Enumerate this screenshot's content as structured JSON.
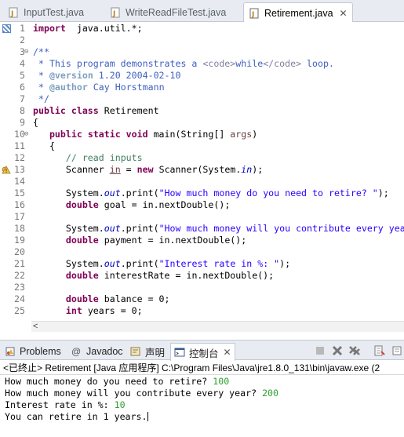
{
  "editor_tabs": [
    {
      "label": "InputTest.java",
      "active": false
    },
    {
      "label": "WriteReadFileTest.java",
      "active": false
    },
    {
      "label": "Retirement.java",
      "active": true
    }
  ],
  "tab_close_glyph": "✕",
  "code_lines": [
    {
      "n": "1",
      "fold": "",
      "segs": [
        [
          "kw",
          "import"
        ],
        [
          "",
          "  java.util.*;"
        ]
      ]
    },
    {
      "n": "2",
      "fold": "",
      "segs": []
    },
    {
      "n": "3",
      "fold": "⊖",
      "segs": [
        [
          "jd",
          "/**"
        ]
      ]
    },
    {
      "n": "4",
      "fold": "",
      "segs": [
        [
          "jd",
          " * This program demonstrates a "
        ],
        [
          "jdhtml",
          "<code>"
        ],
        [
          "jd",
          "while"
        ],
        [
          "jdhtml",
          "</code>"
        ],
        [
          "jd",
          " loop."
        ]
      ]
    },
    {
      "n": "5",
      "fold": "",
      "segs": [
        [
          "jd",
          " * "
        ],
        [
          "jdtag",
          "@version"
        ],
        [
          "jd",
          " 1.20 2004-02-10"
        ]
      ]
    },
    {
      "n": "6",
      "fold": "",
      "segs": [
        [
          "jd",
          " * "
        ],
        [
          "jdtag",
          "@author"
        ],
        [
          "jd",
          " Cay Horstmann"
        ]
      ]
    },
    {
      "n": "7",
      "fold": "",
      "segs": [
        [
          "jd",
          " */"
        ]
      ]
    },
    {
      "n": "8",
      "fold": "",
      "segs": [
        [
          "kw",
          "public class"
        ],
        [
          "",
          " Retirement"
        ]
      ]
    },
    {
      "n": "9",
      "fold": "",
      "segs": [
        [
          "",
          "{"
        ]
      ]
    },
    {
      "n": "10",
      "fold": "⊖",
      "segs": [
        [
          "",
          "   "
        ],
        [
          "kw",
          "public static void"
        ],
        [
          "",
          " main(String[] "
        ],
        [
          "lv",
          "args"
        ],
        [
          "",
          ")"
        ]
      ]
    },
    {
      "n": "11",
      "fold": "",
      "segs": [
        [
          "",
          "   {"
        ]
      ]
    },
    {
      "n": "12",
      "fold": "",
      "segs": [
        [
          "",
          "      "
        ],
        [
          "cm",
          "// read inputs"
        ]
      ]
    },
    {
      "n": "13",
      "fold": "",
      "segs": [
        [
          "",
          "      Scanner "
        ],
        [
          "lvu",
          "in"
        ],
        [
          "",
          " = "
        ],
        [
          "kw",
          "new"
        ],
        [
          "",
          " Scanner(System."
        ],
        [
          "fld",
          "in"
        ],
        [
          "",
          ");"
        ]
      ]
    },
    {
      "n": "14",
      "fold": "",
      "segs": []
    },
    {
      "n": "15",
      "fold": "",
      "segs": [
        [
          "",
          "      System."
        ],
        [
          "fld",
          "out"
        ],
        [
          "",
          ".print("
        ],
        [
          "str",
          "\"How much money do you need to retire? \""
        ],
        [
          "",
          ");"
        ]
      ]
    },
    {
      "n": "16",
      "fold": "",
      "segs": [
        [
          "",
          "      "
        ],
        [
          "kw",
          "double"
        ],
        [
          "",
          " goal = in.nextDouble();"
        ]
      ]
    },
    {
      "n": "17",
      "fold": "",
      "segs": []
    },
    {
      "n": "18",
      "fold": "",
      "segs": [
        [
          "",
          "      System."
        ],
        [
          "fld",
          "out"
        ],
        [
          "",
          ".print("
        ],
        [
          "str",
          "\"How much money will you contribute every yea"
        ]
      ]
    },
    {
      "n": "19",
      "fold": "",
      "segs": [
        [
          "",
          "      "
        ],
        [
          "kw",
          "double"
        ],
        [
          "",
          " payment = in.nextDouble();"
        ]
      ]
    },
    {
      "n": "20",
      "fold": "",
      "segs": []
    },
    {
      "n": "21",
      "fold": "",
      "segs": [
        [
          "",
          "      System."
        ],
        [
          "fld",
          "out"
        ],
        [
          "",
          ".print("
        ],
        [
          "str",
          "\"Interest rate in %: \""
        ],
        [
          "",
          ");"
        ]
      ]
    },
    {
      "n": "22",
      "fold": "",
      "segs": [
        [
          "",
          "      "
        ],
        [
          "kw",
          "double"
        ],
        [
          "",
          " interestRate = in.nextDouble();"
        ]
      ]
    },
    {
      "n": "23",
      "fold": "",
      "segs": []
    },
    {
      "n": "24",
      "fold": "",
      "segs": [
        [
          "",
          "      "
        ],
        [
          "kw",
          "double"
        ],
        [
          "",
          " balance = 0;"
        ]
      ]
    },
    {
      "n": "25",
      "fold": "",
      "segs": [
        [
          "",
          "      "
        ],
        [
          "kw",
          "int"
        ],
        [
          "",
          " years = 0;"
        ]
      ]
    }
  ],
  "scroll_left_glyph": "<",
  "panel_tabs": [
    {
      "label": "Problems",
      "active": false
    },
    {
      "label": "Javadoc",
      "active": false
    },
    {
      "label": "声明",
      "active": false
    },
    {
      "label": "控制台",
      "active": true
    }
  ],
  "console_header": "<已终止> Retirement [Java 应用程序] C:\\Program Files\\Java\\jre1.8.0_131\\bin\\javaw.exe  (2",
  "console_lines": [
    {
      "prompt": "How much money do you need to retire? ",
      "input": "100"
    },
    {
      "prompt": "How much money will you contribute every year? ",
      "input": "200"
    },
    {
      "prompt": "Interest rate in %: ",
      "input": "10"
    },
    {
      "prompt": "You can retire in 1 years.",
      "input": ""
    }
  ],
  "colors": {
    "keyword": "#7f0055",
    "comment": "#3f7f5f",
    "javadoc": "#3f5fbf",
    "string": "#2a00ff",
    "field": "#0000c0",
    "console_input": "#2ea02e"
  }
}
